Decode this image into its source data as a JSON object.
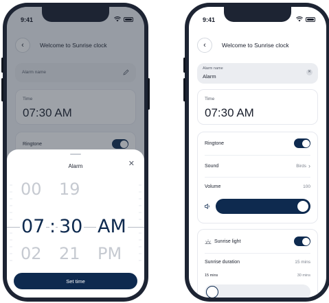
{
  "status": {
    "time": "9:41"
  },
  "left": {
    "title": "Welcome to Sunrise clock",
    "alarm_name_placeholder": "Alarm name",
    "time_label": "Time",
    "time_value": "07:30 AM",
    "ringtone_label": "Ringtone",
    "sheet": {
      "title": "Alarm",
      "picker": {
        "hours_above": "00",
        "minutes_above": "19",
        "hour": "07",
        "separator": ":",
        "minute": "30",
        "ampm": "AM",
        "hours_below": "02",
        "minutes_below": "21",
        "ampm_below": "PM"
      },
      "set_button": "Set time"
    }
  },
  "right": {
    "title": "Welcome to Sunrise clock",
    "alarm_name_label": "Alarm name",
    "alarm_name_value": "Alarm",
    "time_label": "Time",
    "time_value": "07:30 AM",
    "ringtone_label": "Ringtone",
    "sound_label": "Sound",
    "sound_value": "Birds",
    "volume_label": "Volume",
    "volume_value": "100",
    "sunrise_light_label": "Sunrise light",
    "sunrise_duration_label": "Sunrise duration",
    "sunrise_duration_value": "15 mins",
    "duration_min_label": "15 mins",
    "duration_max_label": "30 mins"
  },
  "colors": {
    "accent": "#0e2a4f",
    "background": "#f3f4f7"
  },
  "icons": [
    "back-arrow-icon",
    "pencil-icon",
    "close-icon",
    "chevron-right-icon",
    "speaker-icon",
    "sunrise-icon",
    "wifi-icon",
    "battery-icon"
  ]
}
